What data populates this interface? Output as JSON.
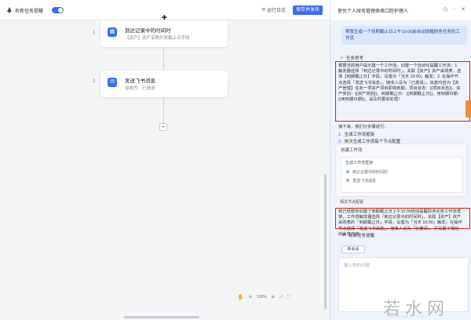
{
  "topbar": {
    "title": "有新任务提醒",
    "run_log": "运行日志",
    "save_publish": "保存并发布"
  },
  "canvas": {
    "node1": {
      "step": "1",
      "title": "到达记录中的时间时",
      "subtitle": "【资产】资产采购列表截止日字段"
    },
    "node2": {
      "step": "2",
      "title": "发送飞书消息",
      "subtitle": "接收方：已邀请"
    },
    "add_symbol": "+",
    "zoom": "100%"
  },
  "panel": {
    "title": "使优个人财务管理表格口腔护理人",
    "user_message": "帮我生成一个到期截止日上午10:00前自动提醒财务任务的工作流",
    "card1_header": "任务思考",
    "paragraph1": "根据当前用户提示建一个工作流，创建一个自动化提醒工作流：1. 触发器选择「到达记录中的时间时」，关联【资产】资产采购表，选择【到期截止日】字段，设置为「当天 10:00」触发；2. 在操作节点选择「发送飞书消息」，接收人设为「已邀请」，消息内容为【资产管理】任务一项资产项目即将到期，项目状态：{{项目状态}}，资产类别：{{资产类别}}，到期截止日：{{到期截止日}}，用到期日期：{{用到期日期}}，请及时跟进处理！",
    "next_intro": "接下来，我们分步骤进行：",
    "steps": [
      {
        "num": "1.",
        "text": "生成工作流框架"
      },
      {
        "num": "2.",
        "text": "依次生成工作流每个节点配置"
      }
    ],
    "wf_card_header": "创建工作流",
    "wf_inner_header": "生成工作流框架",
    "wf_items": [
      "到达记录中的时间时",
      "发送飞书消息"
    ],
    "resp_header": "相关节点配置",
    "paragraph2": "我已经帮你创建了到期截止日上午10:00自动提醒财务任务工作流框架，工作流触发器选择「到达记录中的时间时」，关联【资产】资产采购表的「到期截止日」字段，设置为「当天 10:00」触发；在操作节点选择「发送飞书消息」，接收人设为「已邀请」，并设置了相应的消息内容。",
    "footer_wf": "有新任务提醒",
    "new_chat": "新会话",
    "input_placeholder": "输入你的问题"
  },
  "watermark": {
    "main": "若水网",
    "sub": "RUOSHUI.NET"
  },
  "colors": {
    "accent": "#3a6cf4",
    "highlight_box": "#d9221f",
    "panel_bg": "#eef3fb"
  }
}
